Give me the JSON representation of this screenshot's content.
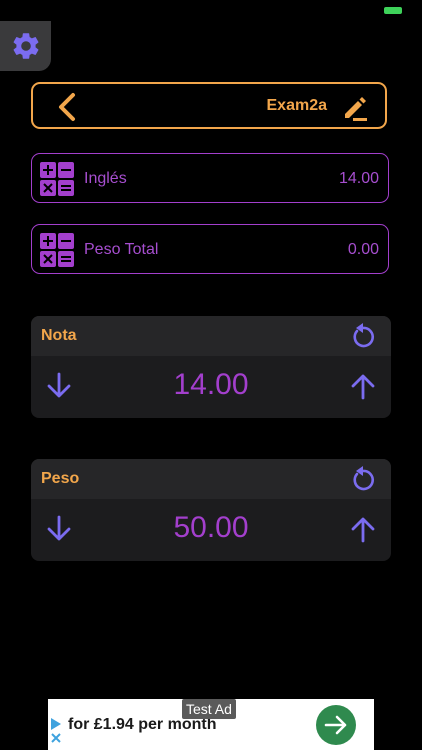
{
  "header": {
    "title": "Exam2a"
  },
  "fields": [
    {
      "label": "Inglés",
      "value": "14.00"
    },
    {
      "label": "Peso Total",
      "value": "0.00"
    }
  ],
  "cards": [
    {
      "title": "Nota",
      "value": "14.00"
    },
    {
      "title": "Peso",
      "value": "50.00"
    }
  ],
  "ad": {
    "tag": "Test Ad",
    "text": "for £1.94 per month"
  },
  "colors": {
    "accent": "#f2a64b",
    "purple": "#a33fcd",
    "icon_purple": "#7b6cf0",
    "battery": "#3ed25a"
  },
  "icons": [
    "gear-icon",
    "back-chevron-icon",
    "edit-pencil-icon",
    "calculator-icon",
    "reset-icon",
    "arrow-down-icon",
    "arrow-up-icon",
    "ad-arrow-icon"
  ]
}
